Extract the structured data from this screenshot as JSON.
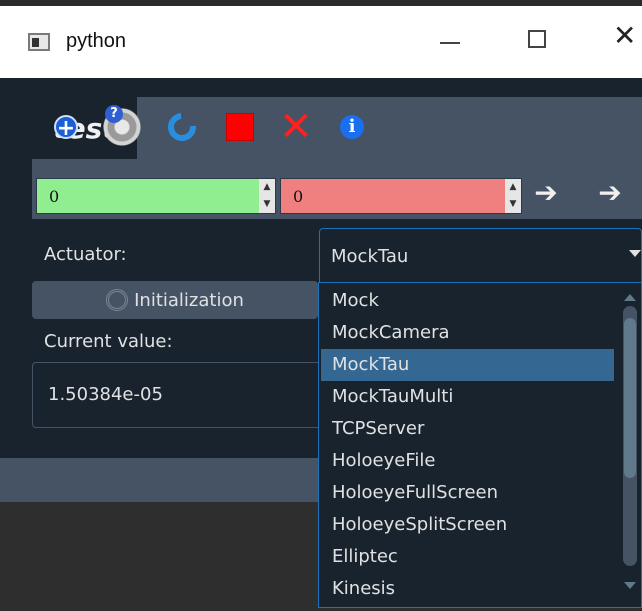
{
  "window": {
    "title": "python",
    "minimize_icon": "minimize-icon",
    "maximize_icon": "maximize-icon",
    "close_glyph": "✕"
  },
  "toolbar": {
    "buttons": [
      {
        "icon": "add-icon"
      },
      {
        "icon": "settings-help-icon"
      },
      {
        "icon": "refresh-icon"
      },
      {
        "icon": "stop-icon"
      },
      {
        "icon": "delete-icon"
      },
      {
        "icon": "info-icon"
      }
    ],
    "tab_label": "test"
  },
  "values": {
    "target_value": "0",
    "relative_value": "0"
  },
  "form": {
    "actuator_label": "Actuator:",
    "actuator_selected": "MockTau",
    "init_label": "Initialization",
    "current_value_label": "Current value:",
    "current_value": "1.50384e-05"
  },
  "dropdown": {
    "options": [
      "Mock",
      "MockCamera",
      "MockTau",
      "MockTauMulti",
      "TCPServer",
      "HoloeyeFile",
      "HoloeyeFullScreen",
      "HoloeyeSplitScreen",
      "Elliptec",
      "Kinesis"
    ],
    "selected_index": 2
  },
  "colors": {
    "background": "#19232d",
    "panel": "#455364",
    "selection": "#346792",
    "green_field": "#90ee90",
    "red_field": "#f08080"
  }
}
